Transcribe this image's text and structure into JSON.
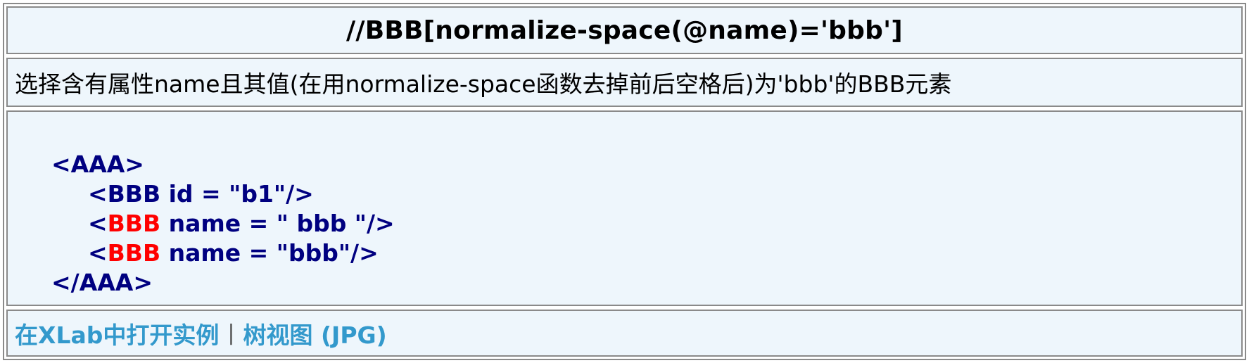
{
  "title": "//BBB[normalize-space(@name)='bbb']",
  "description": "选择含有属性name且其值(在用normalize-space函数去掉前后空格后)为'bbb'的BBB元素",
  "code": {
    "line1": "<AAA>",
    "line2": "<BBB id = \"b1\"/>",
    "line3_open": "<",
    "line3_tag": "BBB",
    "line3_rest": " name = \" bbb \"/>",
    "line4_open": "<",
    "line4_tag": "BBB",
    "line4_rest": " name = \"bbb\"/>",
    "line5": "</AAA>"
  },
  "links": {
    "open_xlab": "在XLab中打开实例",
    "separator": "|",
    "tree_view": "树视图 (JPG)"
  },
  "colors": {
    "cell_background": "#eef6fc",
    "code_text": "#000080",
    "highlight": "#ff0000",
    "link": "#3399cc"
  }
}
